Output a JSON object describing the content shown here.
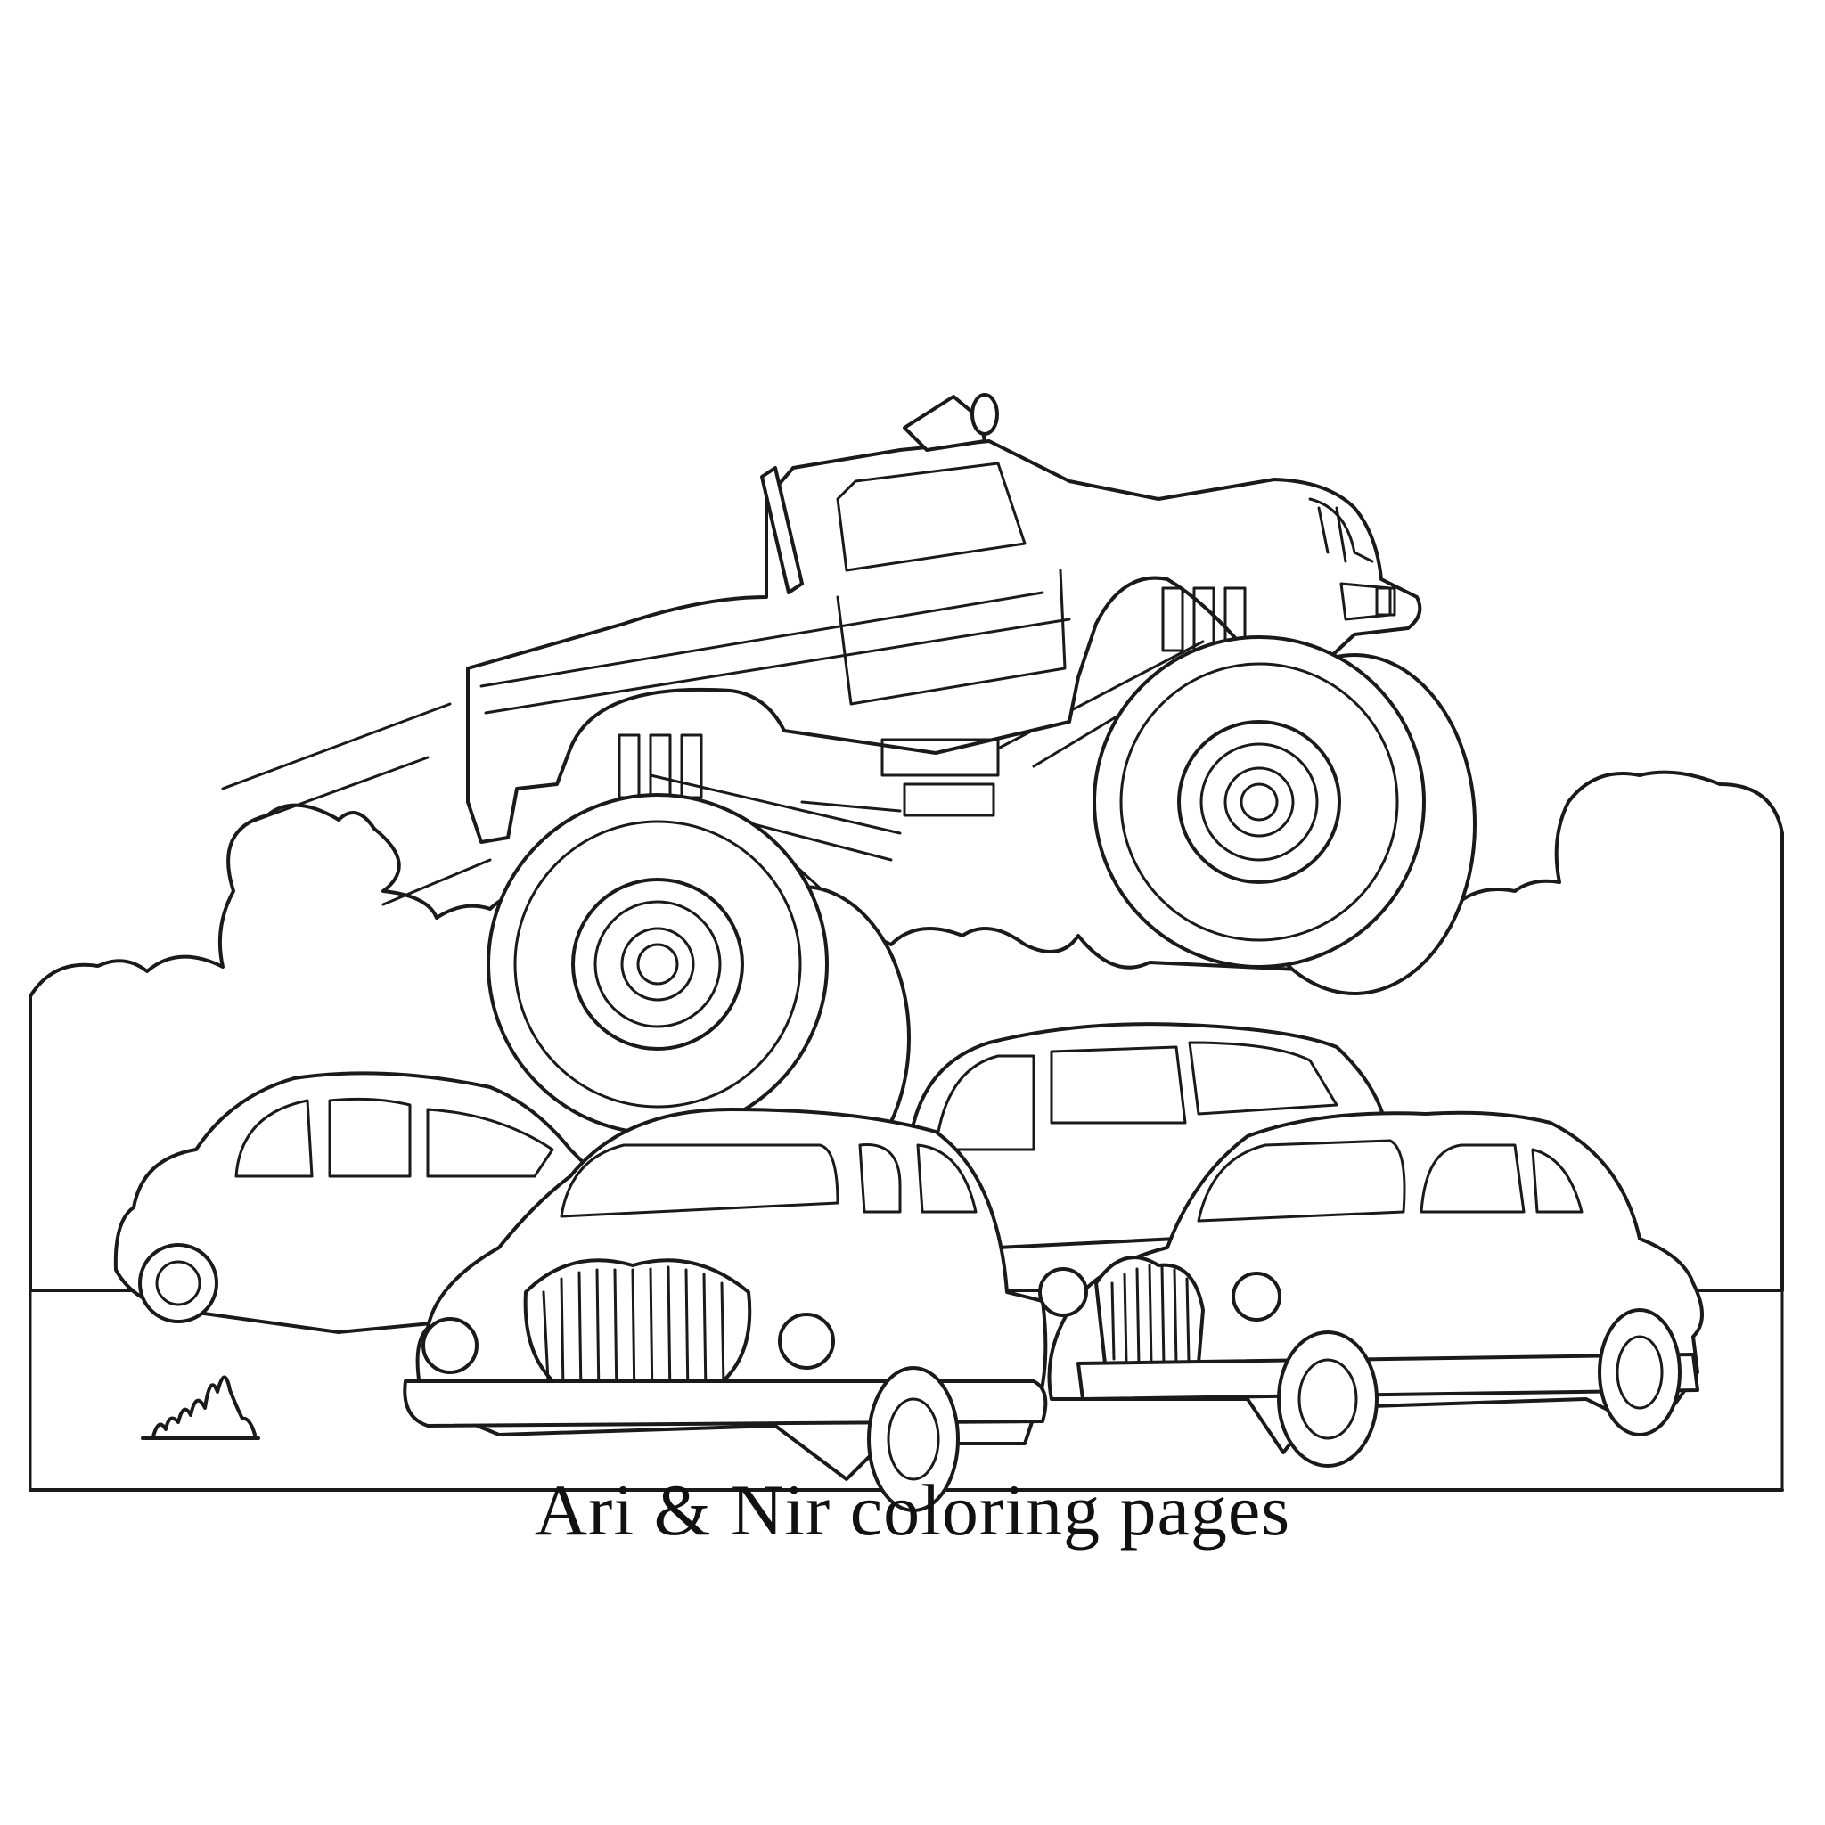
{
  "caption": "Ari & Nir coloring pages",
  "colors": {
    "ink": "#1a1a1a",
    "paper": "#ffffff"
  }
}
